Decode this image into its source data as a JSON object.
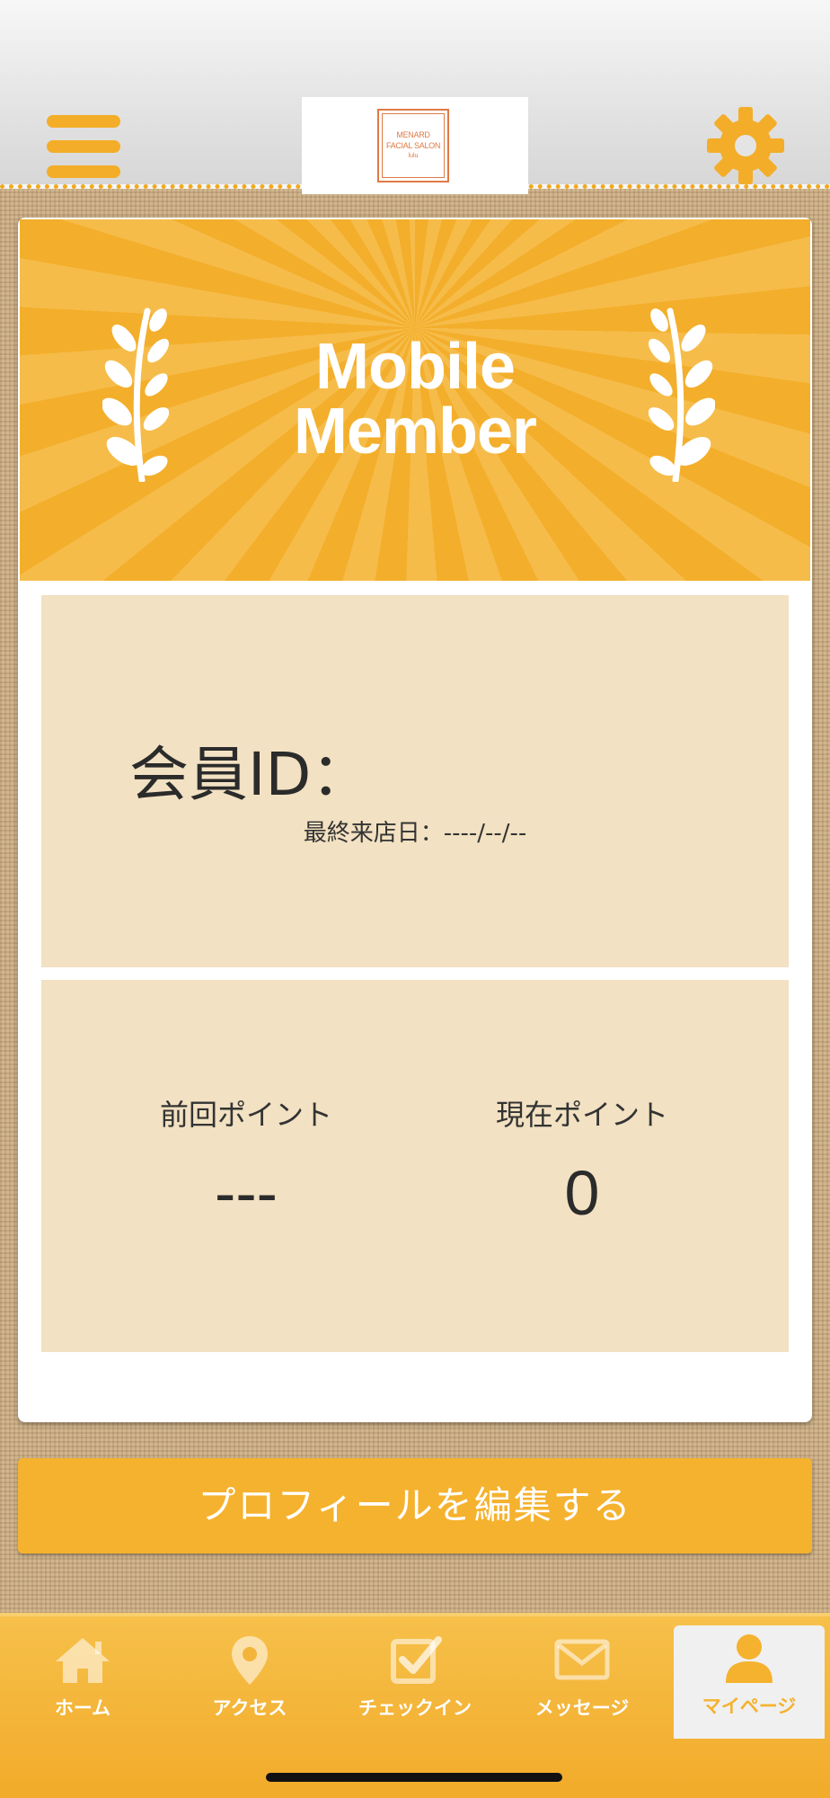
{
  "header": {
    "logo": {
      "line1": "MENARD",
      "line2": "FACIAL SALON",
      "line3": "lulu"
    },
    "menu_icon": "hamburger-menu-icon",
    "settings_icon": "gear-icon"
  },
  "banner": {
    "title_line1": "Mobile",
    "title_line2": "Member"
  },
  "member": {
    "id_label": "会員ID：",
    "last_visit": "最終来店日：----/--/--"
  },
  "points": {
    "previous_label": "前回ポイント",
    "previous_value": "---",
    "current_label": "現在ポイント",
    "current_value": "0"
  },
  "edit_profile_button": "プロフィールを編集する",
  "tabs": [
    {
      "label": "ホーム",
      "icon": "home-icon"
    },
    {
      "label": "アクセス",
      "icon": "map-pin-icon"
    },
    {
      "label": "チェックイン",
      "icon": "checkbox-icon"
    },
    {
      "label": "メッセージ",
      "icon": "envelope-icon"
    },
    {
      "label": "マイページ",
      "icon": "user-icon",
      "active": true
    }
  ],
  "colors": {
    "accent": "#f5b22e",
    "panel": "#f2e1c2"
  }
}
